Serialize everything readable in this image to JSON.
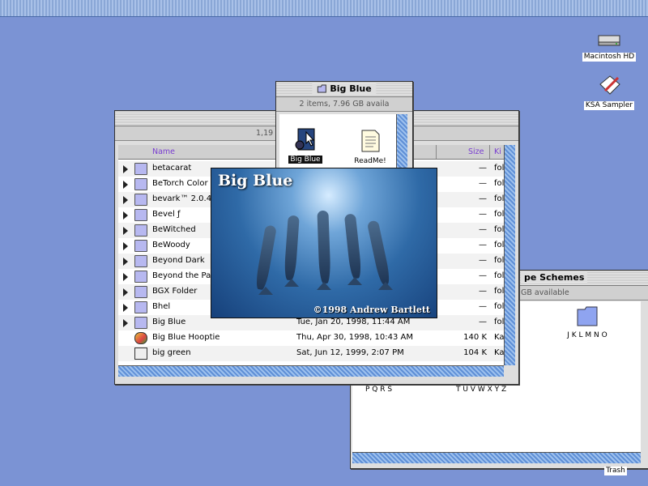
{
  "desktop": {
    "icons": [
      {
        "label": "Macintosh HD",
        "icon": "hard-disk-icon"
      },
      {
        "label": "KSA Sampler",
        "icon": "document-pen-icon"
      },
      {
        "label": "Trash",
        "icon": "trash-icon"
      }
    ]
  },
  "schemes_window": {
    "title": "pe Schemes",
    "info": "GB available",
    "folder_label": "J K L M N O",
    "row_labels": [
      "P Q R S",
      "T U V W X Y Z"
    ]
  },
  "list_window": {
    "info": "1,19",
    "columns": {
      "name": "Name",
      "size": "Size",
      "kind": "Ki"
    },
    "rows": [
      {
        "name": "betacarat",
        "date": "",
        "size": "—",
        "kind": "fol",
        "icon": "folder-icon",
        "expandable": true
      },
      {
        "name": "BeTorch Color",
        "date": "",
        "size": "—",
        "kind": "fol",
        "icon": "folder-icon",
        "expandable": true
      },
      {
        "name": "bevark™ 2.0.4",
        "date": "",
        "size": "—",
        "kind": "fol",
        "icon": "folder-icon",
        "expandable": true
      },
      {
        "name": "Bevel ƒ",
        "date": "",
        "size": "—",
        "kind": "fol",
        "icon": "folder-icon",
        "expandable": true
      },
      {
        "name": "BeWitched",
        "date": "",
        "size": "—",
        "kind": "fol",
        "icon": "folder-icon",
        "expandable": true
      },
      {
        "name": "BeWoody",
        "date": "",
        "size": "—",
        "kind": "fol",
        "icon": "folder-icon",
        "expandable": true
      },
      {
        "name": "Beyond Dark",
        "date": "",
        "size": "—",
        "kind": "fol",
        "icon": "folder-icon",
        "expandable": true
      },
      {
        "name": "Beyond the Pal",
        "date": "",
        "size": "—",
        "kind": "fol",
        "icon": "folder-icon",
        "expandable": true
      },
      {
        "name": "BGX Folder",
        "date": "",
        "size": "—",
        "kind": "fol",
        "icon": "folder-icon",
        "expandable": true
      },
      {
        "name": "Bhel",
        "date": "",
        "size": "—",
        "kind": "fol",
        "icon": "folder-icon",
        "expandable": true
      },
      {
        "name": "Big Blue",
        "date": "Tue, Jan 20, 1998, 11:44 AM",
        "size": "—",
        "kind": "fol",
        "icon": "folder-icon",
        "expandable": true
      },
      {
        "name": "Big Blue Hooptie",
        "date": "Thu, Apr 30, 1998, 10:43 AM",
        "size": "140 K",
        "kind": "Ka",
        "icon": "app-icon",
        "expandable": false
      },
      {
        "name": "big green",
        "date": "Sat, Jun 12, 1999, 2:07 PM",
        "size": "104 K",
        "kind": "Ka",
        "icon": "document-icon",
        "expandable": false
      }
    ]
  },
  "bigblue_window": {
    "title": "Big Blue",
    "info": "2 items, 7.96 GB availa",
    "items": [
      {
        "label": "Big Blue",
        "icon": "theme-app-icon",
        "selected": true
      },
      {
        "label": "ReadMe!",
        "icon": "readme-document-icon",
        "selected": false
      }
    ]
  },
  "splash": {
    "title": "Big Blue",
    "copyright": "©1998 Andrew Bartlett"
  }
}
